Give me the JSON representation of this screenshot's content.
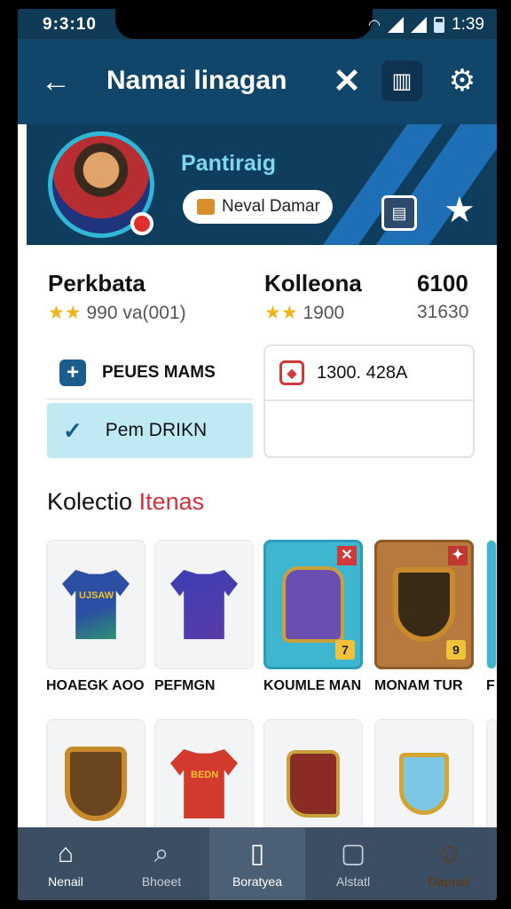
{
  "status_bar": {
    "time": "9:3:10",
    "right_time": "1:39",
    "icons": [
      "wifi-icon",
      "signal-icon",
      "signal-icon",
      "battery-icon"
    ]
  },
  "header": {
    "title": "Namai linagan",
    "back_icon": "arrow-left-icon",
    "close_icon": "close-icon",
    "bookmark_icon": "bookmark-icon",
    "settings_icon": "gear-icon"
  },
  "profile": {
    "name": "Pantiraig",
    "tag_label": "Neval Damar",
    "tag_icon": "briefcase-icon",
    "card_icon": "id-card-icon",
    "star_icon": "star-icon"
  },
  "stats": {
    "left": {
      "title": "Perkbata",
      "sub": "990 va(001)",
      "stars": "★★"
    },
    "right": {
      "title": "Kolleona",
      "sub": "1900",
      "stars": "★★",
      "value": "6100",
      "value_sub": "31630"
    }
  },
  "actions": {
    "primary": {
      "label": "PEUES MAMS",
      "icon": "plus-icon"
    },
    "checked": {
      "label": "Pem DRIKN",
      "icon": "check-icon"
    },
    "right_row": {
      "label": "1300. 428A",
      "icon": "shield-icon"
    }
  },
  "collection": {
    "title": "Kolectio",
    "title_accent": "Itenas",
    "items": [
      {
        "caption": "HOAEGK AOO",
        "art": "jersey-green-icon",
        "shirt_text": "UJSAW"
      },
      {
        "caption": "PEFMGN",
        "art": "jersey-purple-icon",
        "shirt_text": ""
      },
      {
        "caption": "KOUMLE MAN",
        "art": "robe-icon",
        "badge": "7"
      },
      {
        "caption": "MONAM TUR",
        "art": "shield-gem-icon",
        "badge": "9"
      },
      {
        "caption": "F",
        "art": "partial-item-icon"
      },
      {
        "caption": "",
        "art": "shield-star-icon"
      },
      {
        "caption": "",
        "art": "jersey-red-icon",
        "shirt_text": "BEDN"
      },
      {
        "caption": "",
        "art": "boot-icon"
      },
      {
        "caption": "",
        "art": "trophy-icon"
      }
    ]
  },
  "nav": [
    {
      "label": "Nenail",
      "icon": "home-icon"
    },
    {
      "label": "Bhoeet",
      "icon": "search-icon"
    },
    {
      "label": "Boratyea",
      "icon": "card-icon"
    },
    {
      "label": "Alstatl",
      "icon": "square-icon"
    },
    {
      "label": "Dapnai",
      "icon": "profile-icon"
    }
  ]
}
